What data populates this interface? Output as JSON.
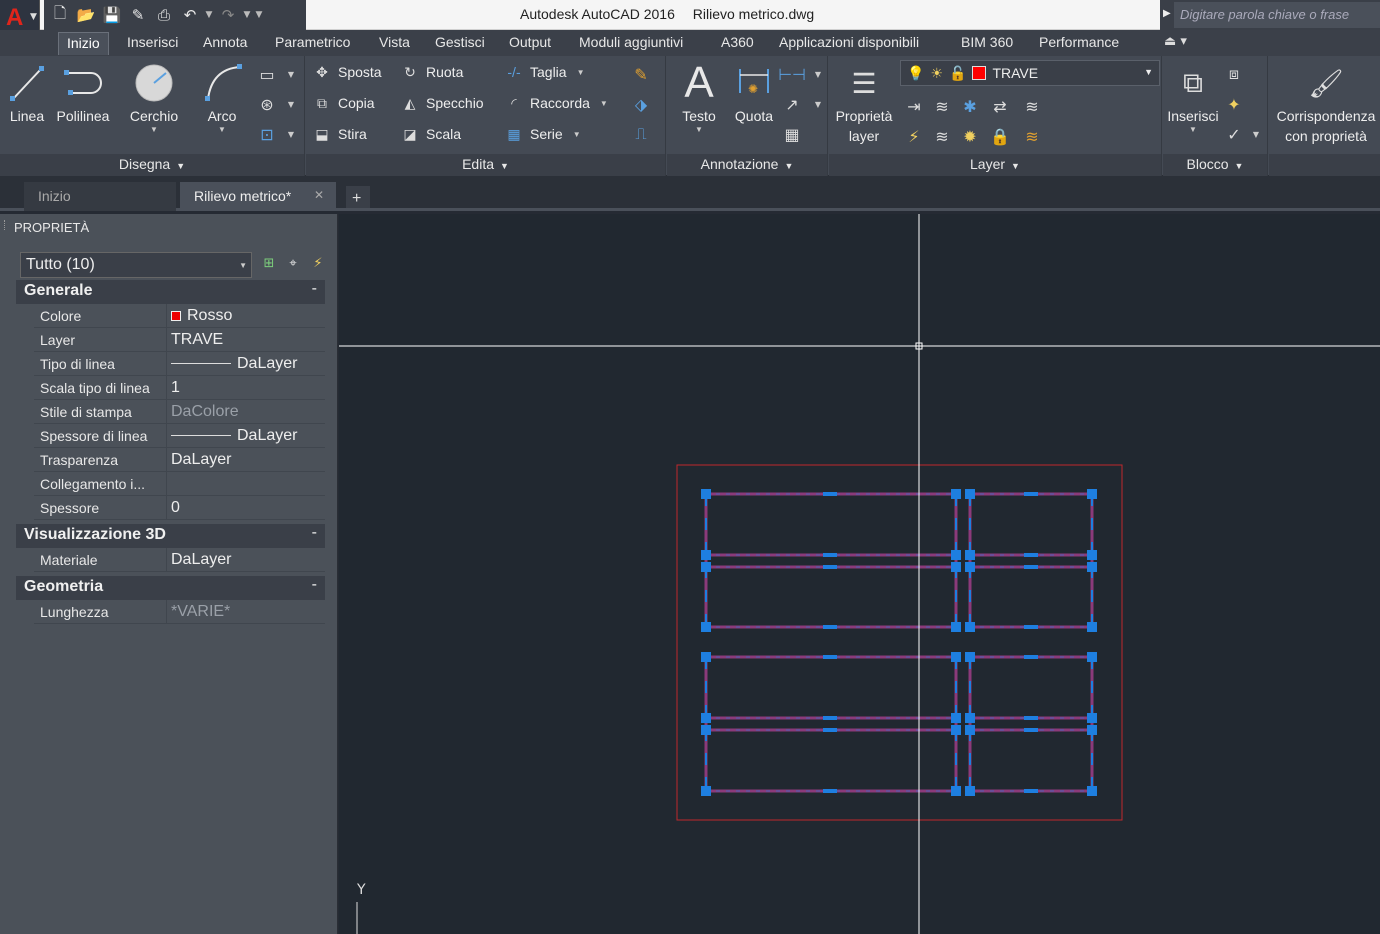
{
  "app": {
    "title_app": "Autodesk AutoCAD 2016",
    "title_file": "Rilievo metrico.dwg",
    "search_placeholder": "Digitare parola chiave o frase"
  },
  "menu_tabs": [
    "Inizio",
    "Inserisci",
    "Annota",
    "Parametrico",
    "Vista",
    "Gestisci",
    "Output",
    "Moduli aggiuntivi",
    "A360",
    "Applicazioni disponibili",
    "BIM 360",
    "Performance"
  ],
  "ribbon": {
    "disegna": {
      "title": "Disegna",
      "linea": "Linea",
      "polilinea": "Polilinea",
      "cerchio": "Cerchio",
      "arco": "Arco"
    },
    "edita": {
      "title": "Edita",
      "sposta": "Sposta",
      "ruota": "Ruota",
      "taglia": "Taglia",
      "copia": "Copia",
      "specchio": "Specchio",
      "raccorda": "Raccorda",
      "stira": "Stira",
      "scala": "Scala",
      "serie": "Serie"
    },
    "annotazione": {
      "title": "Annotazione",
      "testo": "Testo",
      "quota": "Quota"
    },
    "layer": {
      "title": "Layer",
      "prop1": "Proprietà",
      "prop2": "layer",
      "current": "TRAVE",
      "current_color": "#ff0000"
    },
    "blocco": {
      "title": "Blocco",
      "inserisci": "Inserisci"
    },
    "corrisp": {
      "l1": "Corrispondenza",
      "l2": "con proprietà"
    }
  },
  "doc_tabs": {
    "start": "Inizio",
    "active": "Rilievo metrico*"
  },
  "properties": {
    "title": "PROPRIETÀ",
    "selection": "Tutto (10)",
    "generale": {
      "title": "Generale",
      "rows": [
        {
          "k": "Colore",
          "v": "Rosso"
        },
        {
          "k": "Layer",
          "v": "TRAVE"
        },
        {
          "k": "Tipo di linea",
          "v": "DaLayer"
        },
        {
          "k": "Scala tipo di linea",
          "v": "1"
        },
        {
          "k": "Stile di stampa",
          "v": "DaColore"
        },
        {
          "k": "Spessore di linea",
          "v": "DaLayer"
        },
        {
          "k": "Trasparenza",
          "v": "DaLayer"
        },
        {
          "k": "Collegamento i...",
          "v": ""
        },
        {
          "k": "Spessore",
          "v": "0"
        }
      ]
    },
    "vis3d": {
      "title": "Visualizzazione 3D",
      "rows": [
        {
          "k": "Materiale",
          "v": "DaLayer"
        }
      ]
    },
    "geometria": {
      "title": "Geometria",
      "rows": [
        {
          "k": "Lunghezza",
          "v": "*VARIE*"
        }
      ]
    },
    "collapse": "-"
  },
  "canvas": {
    "ucs_y": "Y"
  },
  "colors": {
    "beam": "#8b3a7a",
    "grip": "#1e7fe0",
    "selection": "#c0272d",
    "crosshair": "#ffffff"
  }
}
